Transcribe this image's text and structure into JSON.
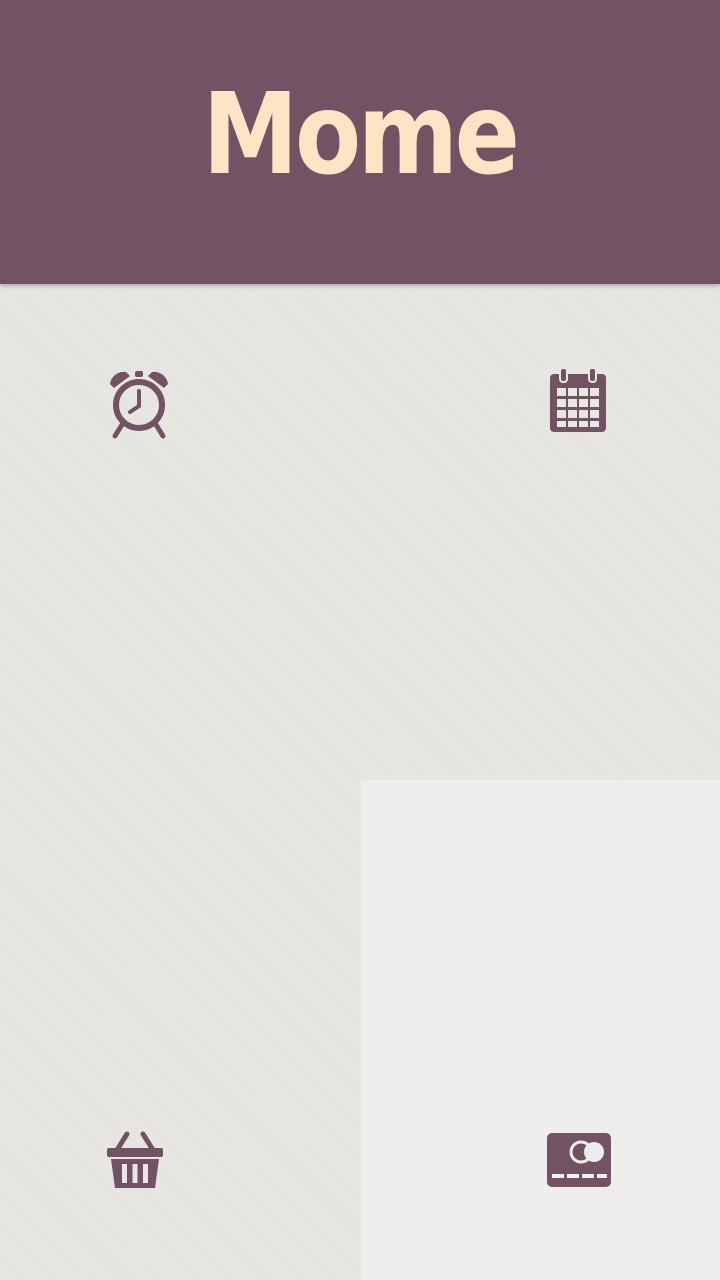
{
  "app": {
    "title": "Mome",
    "colors": {
      "header_bg": "#725363",
      "title_text": "#fde4c4",
      "icon": "#725363",
      "background": "#e9e7e3",
      "selected_tile": "#efeeec"
    }
  },
  "tiles": [
    {
      "icon": "alarm-clock-icon"
    },
    {
      "icon": "calendar-icon"
    },
    {
      "icon": "shopping-basket-icon"
    },
    {
      "icon": "credit-card-icon",
      "selected": true
    }
  ]
}
